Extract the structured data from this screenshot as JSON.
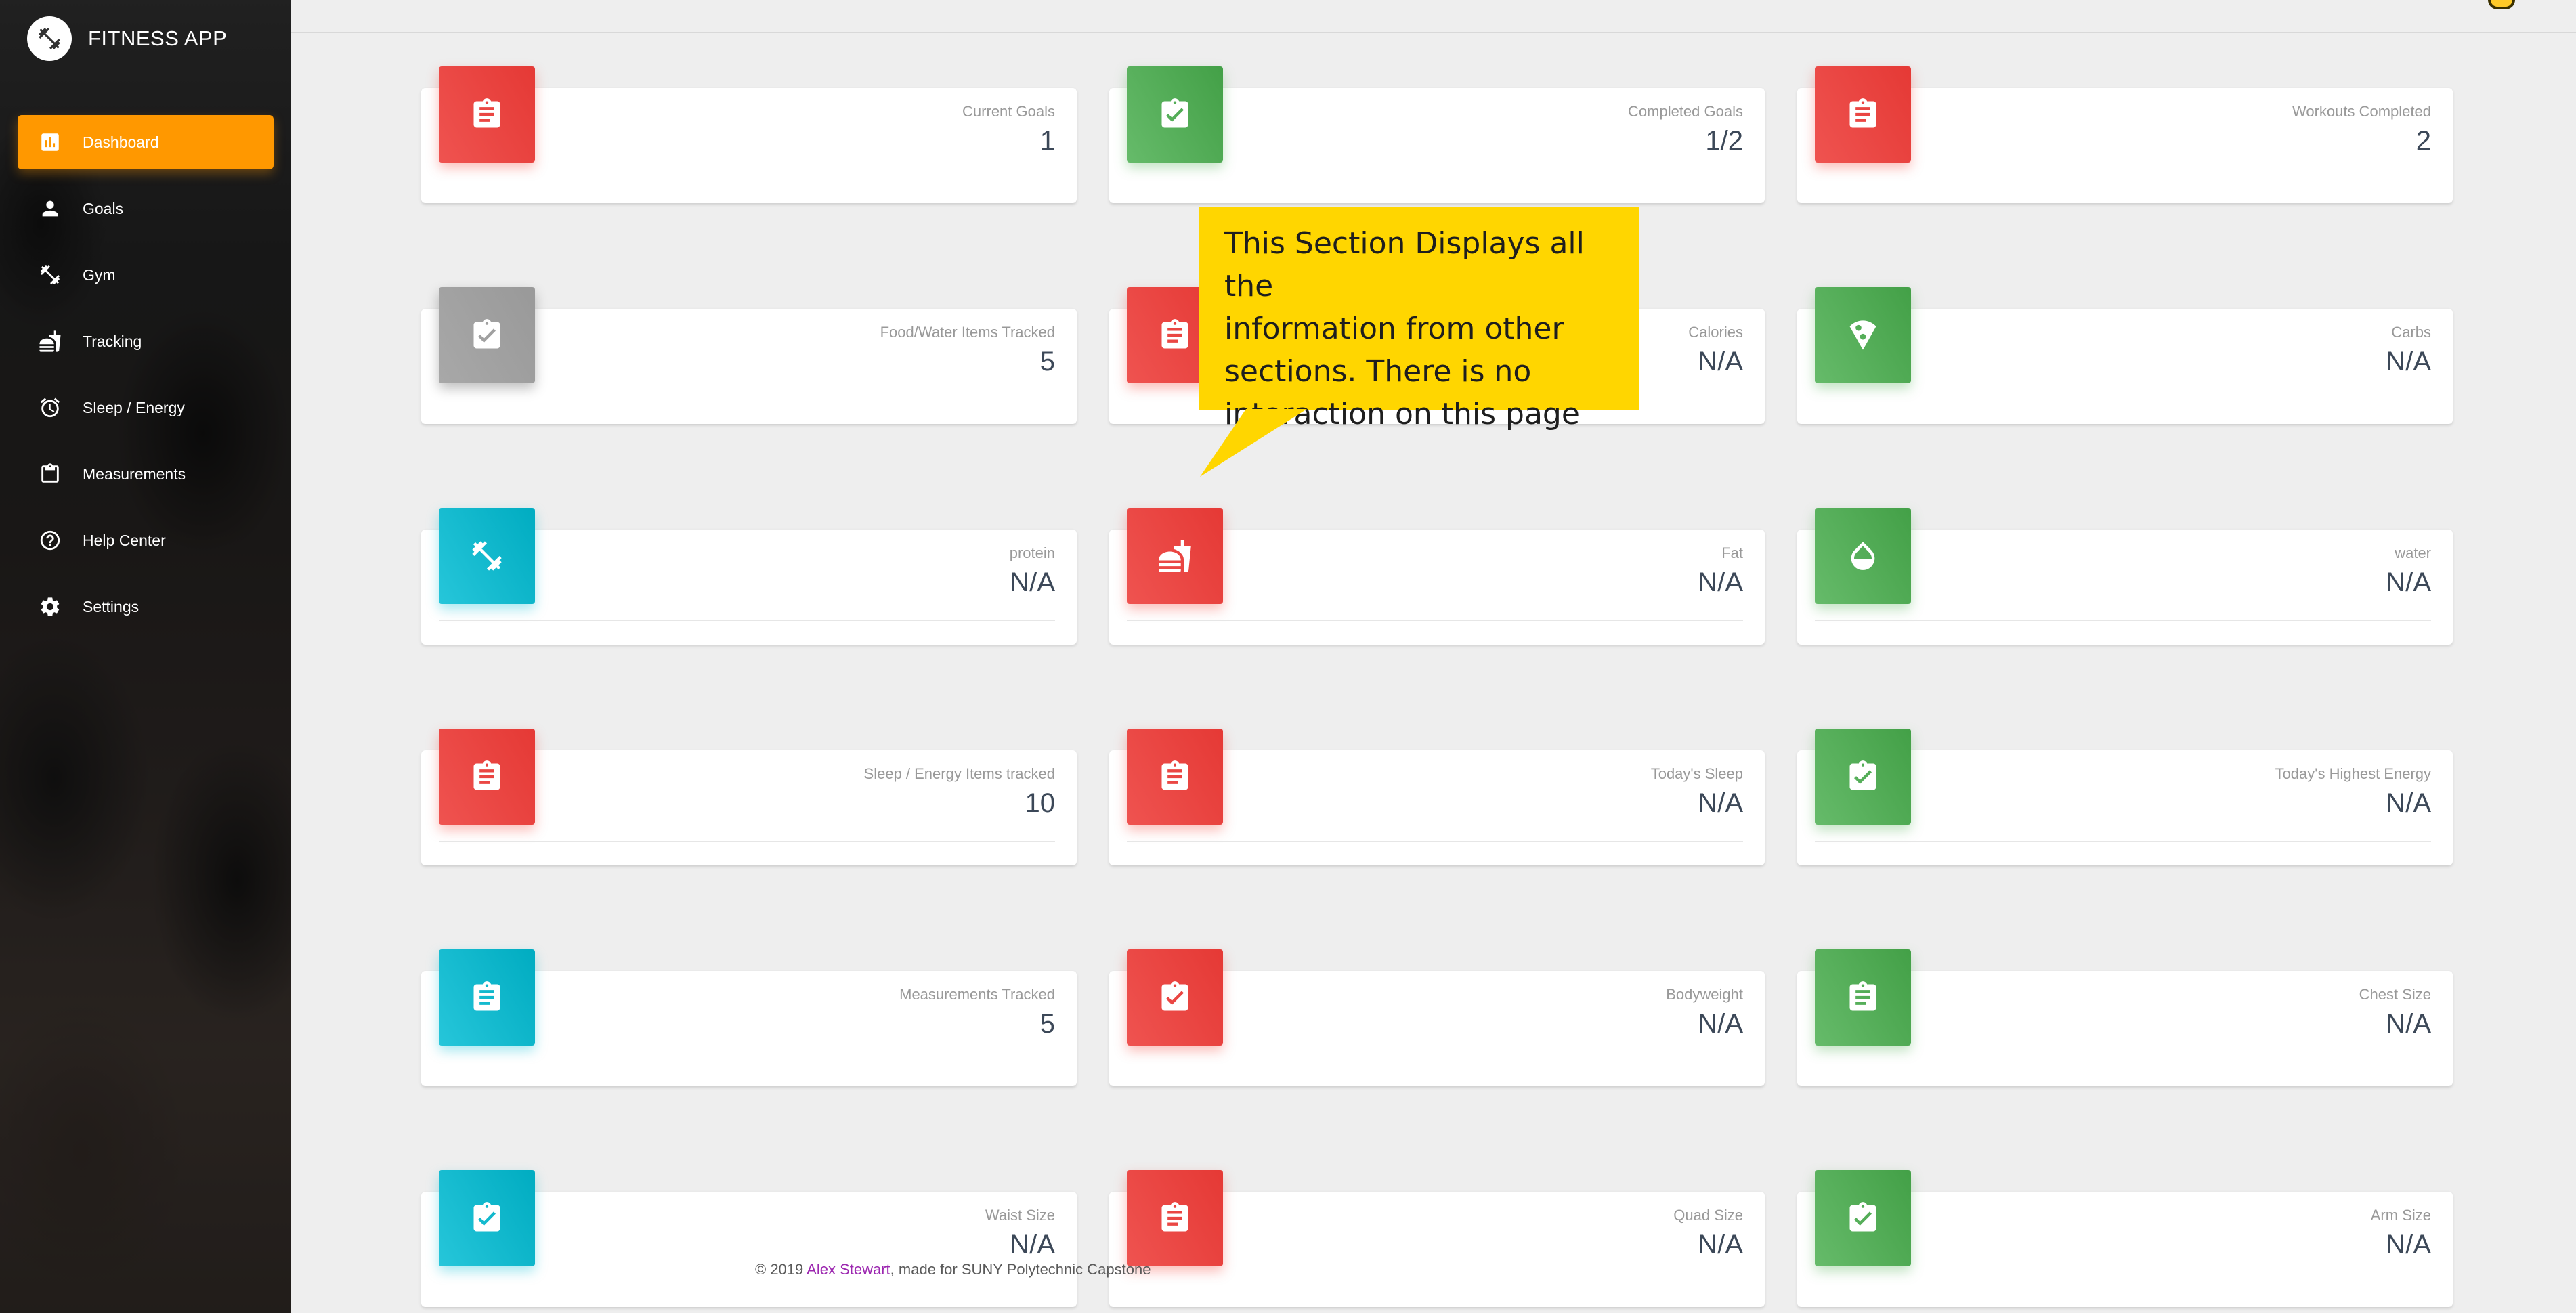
{
  "app": {
    "name": "FITNESS APP",
    "logo_icon": "dumbbell-icon"
  },
  "sidebar": {
    "items": [
      {
        "label": "Dashboard",
        "icon": "bar-chart-icon",
        "active": true
      },
      {
        "label": "Goals",
        "icon": "person-icon",
        "active": false
      },
      {
        "label": "Gym",
        "icon": "fitness-center-icon",
        "active": false
      },
      {
        "label": "Tracking",
        "icon": "fastfood-icon",
        "active": false
      },
      {
        "label": "Sleep / Energy",
        "icon": "alarm-icon",
        "active": false
      },
      {
        "label": "Measurements",
        "icon": "clipboard-icon",
        "active": false
      },
      {
        "label": "Help Center",
        "icon": "help-icon",
        "active": false
      },
      {
        "label": "Settings",
        "icon": "gear-icon",
        "active": false
      }
    ],
    "active_color": "#ff9800"
  },
  "cards": [
    {
      "title": "Current Goals",
      "value": "1",
      "color": "red",
      "icon": "assignment-icon"
    },
    {
      "title": "Completed Goals",
      "value": "1/2",
      "color": "green",
      "icon": "assignment-check-icon"
    },
    {
      "title": "Workouts Completed",
      "value": "2",
      "color": "red",
      "icon": "assignment-icon"
    },
    {
      "title": "Food/Water Items Tracked",
      "value": "5",
      "color": "grey",
      "icon": "assignment-check-icon"
    },
    {
      "title": "Calories",
      "value": "N/A",
      "color": "red",
      "icon": "assignment-icon"
    },
    {
      "title": "Carbs",
      "value": "N/A",
      "color": "green",
      "icon": "pizza-icon"
    },
    {
      "title": "protein",
      "value": "N/A",
      "color": "cyan",
      "icon": "fitness-center-icon"
    },
    {
      "title": "Fat",
      "value": "N/A",
      "color": "red",
      "icon": "fastfood-icon"
    },
    {
      "title": "water",
      "value": "N/A",
      "color": "green",
      "icon": "water-drop-icon"
    },
    {
      "title": "Sleep / Energy Items tracked",
      "value": "10",
      "color": "red",
      "icon": "assignment-icon"
    },
    {
      "title": "Today's Sleep",
      "value": "N/A",
      "color": "red",
      "icon": "assignment-icon"
    },
    {
      "title": "Today's Highest Energy",
      "value": "N/A",
      "color": "green",
      "icon": "assignment-check-icon"
    },
    {
      "title": "Measurements Tracked",
      "value": "5",
      "color": "cyan",
      "icon": "assignment-icon"
    },
    {
      "title": "Bodyweight",
      "value": "N/A",
      "color": "red",
      "icon": "assignment-check-icon"
    },
    {
      "title": "Chest Size",
      "value": "N/A",
      "color": "green",
      "icon": "assignment-icon"
    },
    {
      "title": "Waist Size",
      "value": "N/A",
      "color": "cyan",
      "icon": "assignment-check-icon"
    },
    {
      "title": "Quad Size",
      "value": "N/A",
      "color": "red",
      "icon": "assignment-icon"
    },
    {
      "title": "Arm Size",
      "value": "N/A",
      "color": "green",
      "icon": "assignment-check-icon"
    }
  ],
  "callout": {
    "lines": [
      "This Section Displays all the",
      "information from other",
      "sections. There is no",
      "interaction on this page"
    ],
    "color": "#ffd600"
  },
  "footer": {
    "prefix": "© 2019 ",
    "author": "Alex Stewart",
    "suffix": ", made for SUNY Polytechnic Capstone"
  },
  "colors": {
    "red": "#e53935",
    "green": "#43a047",
    "cyan": "#00acc1",
    "grey": "#999999",
    "background": "#eeeeee"
  }
}
